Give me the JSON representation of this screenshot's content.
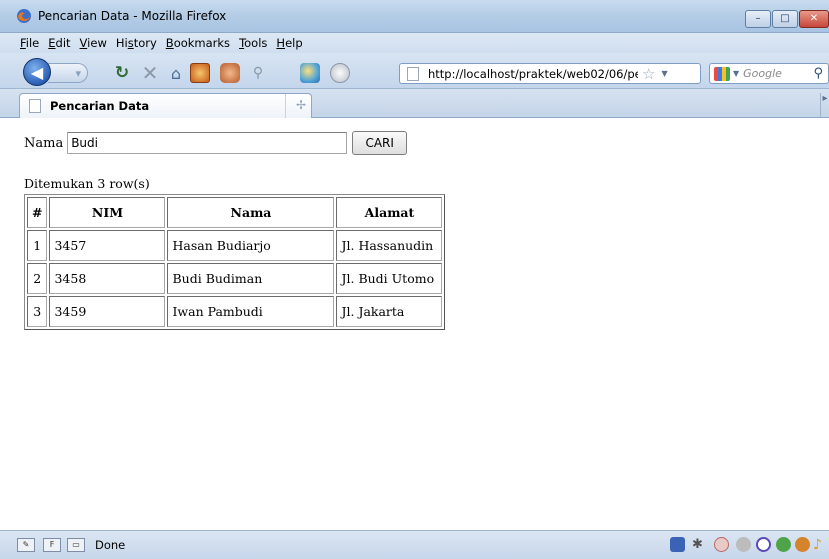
{
  "window": {
    "title": "Pencarian Data - Mozilla Firefox",
    "controls": {
      "minimize": "–",
      "maximize": "□",
      "close": "✕"
    }
  },
  "menubar": {
    "items": [
      {
        "label": "File",
        "mnemonic": "F",
        "rest": "ile"
      },
      {
        "label": "Edit",
        "mnemonic": "E",
        "rest": "dit"
      },
      {
        "label": "View",
        "mnemonic": "V",
        "rest": "iew"
      },
      {
        "label": "History",
        "mnemonic": "s",
        "pre": "Hi",
        "rest": "tory"
      },
      {
        "label": "Bookmarks",
        "mnemonic": "B",
        "rest": "ookmarks"
      },
      {
        "label": "Tools",
        "mnemonic": "T",
        "rest": "ools"
      },
      {
        "label": "Help",
        "mnemonic": "H",
        "rest": "elp"
      }
    ]
  },
  "navbar": {
    "url": "http://localhost/praktek/web02/06/per",
    "search_placeholder": "Google",
    "icons": [
      "back-icon",
      "forward-icon",
      "reload-icon",
      "stop-icon",
      "home-icon",
      "extension-icon",
      "extension-icon",
      "extension-icon",
      "extension-icon",
      "extension-icon",
      "page-icon",
      "bookmark-star-icon",
      "search-engine-icon",
      "magnifier-icon"
    ]
  },
  "tabs": [
    {
      "label": "Pencarian Data",
      "active": true
    }
  ],
  "page": {
    "form": {
      "label": "Nama",
      "input_value": "Budi",
      "button_label": "CARI"
    },
    "result_count_text": "Ditemukan 3 row(s)",
    "table": {
      "headers": [
        "#",
        "NIM",
        "Nama",
        "Alamat"
      ],
      "rows": [
        [
          "1",
          "3457",
          "Hasan Budiarjo",
          "Jl. Hassanudin"
        ],
        [
          "2",
          "3458",
          "Budi Budiman",
          "Jl. Budi Utomo"
        ],
        [
          "3",
          "3459",
          "Iwan Pambudi",
          "Jl. Jakarta"
        ]
      ]
    }
  },
  "statusbar": {
    "text": "Done"
  },
  "colors": {
    "chrome": "#c4d6ec",
    "accent": "#2a5fb4"
  }
}
